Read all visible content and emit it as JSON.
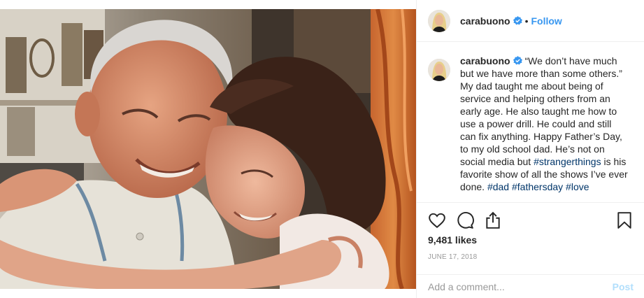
{
  "post": {
    "header": {
      "username": "carabuono",
      "separator": "•",
      "follow_label": "Follow"
    },
    "caption": {
      "username": "carabuono",
      "text_before": "“We don’t have much but we have more than some others.” My dad taught me about being of service and helping others from an early age. He also taught me how to use a power drill. He could and still can fix anything. Happy Father’s Day, to my old school dad. He’s not on social media but ",
      "hashtag_strangerthings": "#strangerthings",
      "text_after": " is his favorite show of all the shows I’ve ever done. ",
      "hashtag_dad": "#dad",
      "hashtag_fathersday": "#fathersday",
      "hashtag_love": "#love"
    },
    "actions": {
      "icons": [
        "heart-icon",
        "comment-icon",
        "share-icon",
        "bookmark-icon"
      ]
    },
    "likes": "9,481 likes",
    "date": "JUNE 17, 2018",
    "comment": {
      "placeholder": "Add a comment...",
      "post_label": "Post"
    },
    "colors": {
      "link_blue": "#3897f0",
      "hashtag": "#003569",
      "post_disabled": "#b2dffc",
      "verified": "#3897f0"
    }
  }
}
